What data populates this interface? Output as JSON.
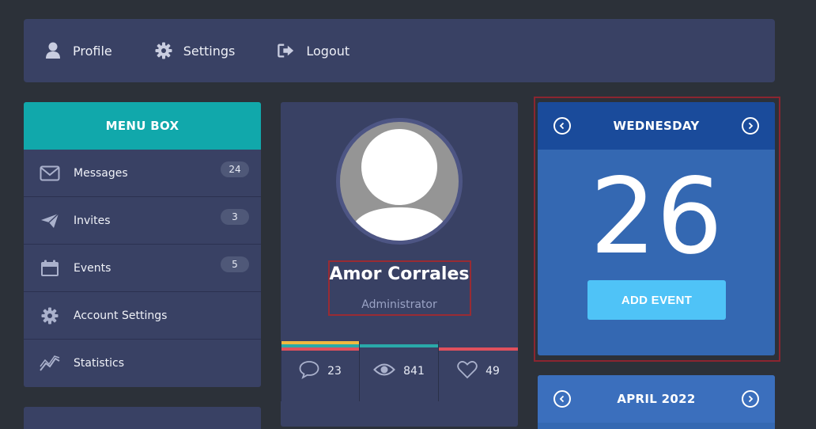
{
  "nav": {
    "items": [
      {
        "label": "Profile",
        "icon": "user-icon"
      },
      {
        "label": "Settings",
        "icon": "gear-icon"
      },
      {
        "label": "Logout",
        "icon": "logout-icon"
      }
    ]
  },
  "menu": {
    "title": "MENU BOX",
    "items": [
      {
        "label": "Messages",
        "badge": "24",
        "icon": "envelope-icon"
      },
      {
        "label": "Invites",
        "badge": "3",
        "icon": "paper-plane-icon"
      },
      {
        "label": "Events",
        "badge": "5",
        "icon": "calendar-icon"
      },
      {
        "label": "Account Settings",
        "icon": "gear-icon"
      },
      {
        "label": "Statistics",
        "icon": "chart-line-icon"
      }
    ]
  },
  "profile": {
    "name": "Amor Corrales",
    "role": "Administrator",
    "stats": [
      {
        "icon": "comment-icon",
        "value": "23"
      },
      {
        "icon": "eye-icon",
        "value": "841"
      },
      {
        "icon": "heart-icon",
        "value": "49"
      }
    ],
    "bar_colors": [
      "#f0b940",
      "#2aa9a9",
      "#e0505d"
    ]
  },
  "calendar": {
    "weekday": "WEDNESDAY",
    "day": "26",
    "add_event_label": "ADD EVENT",
    "month_label": "APRIL 2022"
  },
  "colors": {
    "background": "#2c3139",
    "panel": "#394164",
    "teal": "#11a8ab",
    "calendar_blue": "#3468b2",
    "calendar_header": "#1a4b9b",
    "add_event": "#4fc3f7"
  }
}
